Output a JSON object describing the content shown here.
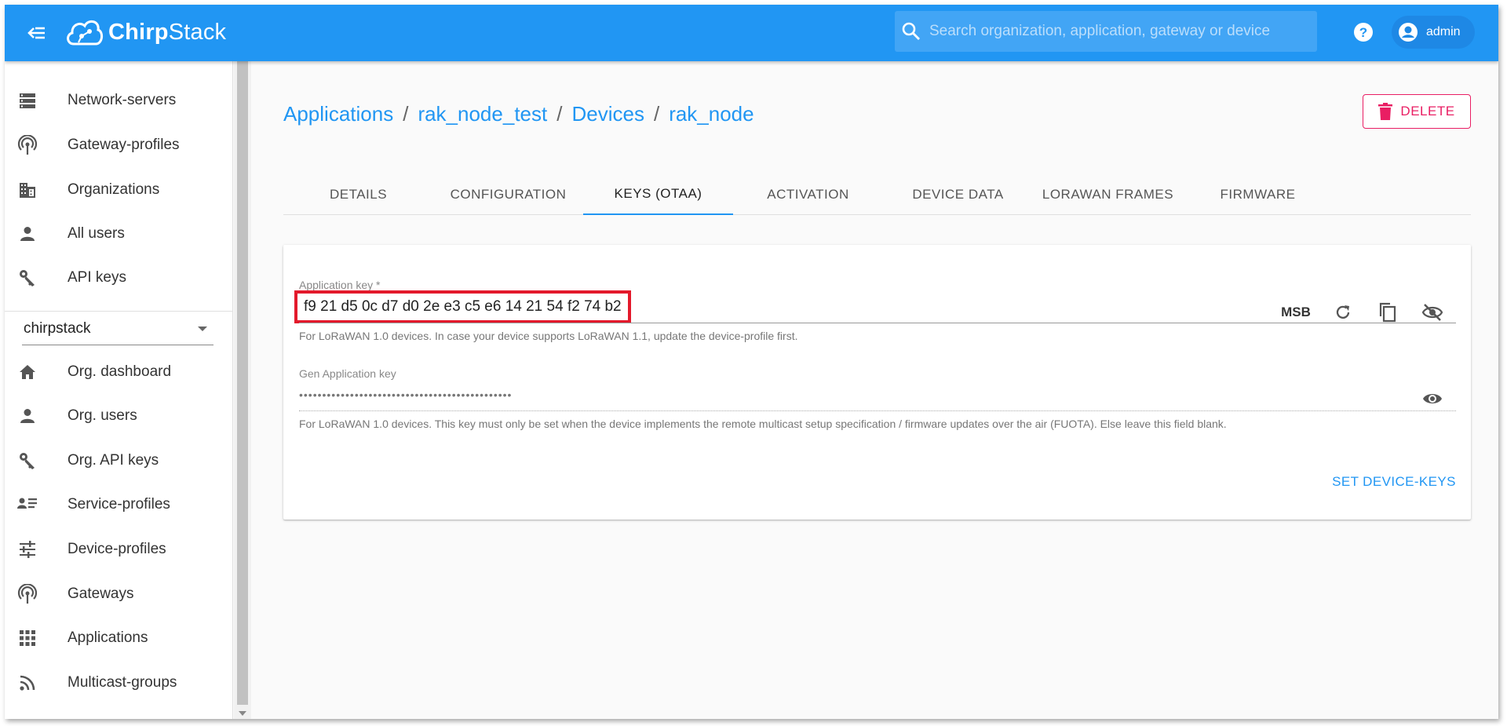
{
  "header": {
    "logo_text_bold": "Chirp",
    "logo_text_light": "Stack",
    "search_placeholder": "Search organization, application, gateway or device",
    "user_label": "admin"
  },
  "sidebar": {
    "global_items": [
      {
        "label": "Network-servers",
        "icon": "server-icon"
      },
      {
        "label": "Gateway-profiles",
        "icon": "gateway-icon"
      },
      {
        "label": "Organizations",
        "icon": "building-icon"
      },
      {
        "label": "All users",
        "icon": "person-icon"
      },
      {
        "label": "API keys",
        "icon": "key-icon"
      }
    ],
    "org_selected": "chirpstack",
    "org_items": [
      {
        "label": "Org. dashboard",
        "icon": "home-icon"
      },
      {
        "label": "Org. users",
        "icon": "person-icon"
      },
      {
        "label": "Org. API keys",
        "icon": "key-icon"
      },
      {
        "label": "Service-profiles",
        "icon": "profile-list-icon"
      },
      {
        "label": "Device-profiles",
        "icon": "sliders-icon"
      },
      {
        "label": "Gateways",
        "icon": "gateway-icon"
      },
      {
        "label": "Applications",
        "icon": "apps-grid-icon"
      },
      {
        "label": "Multicast-groups",
        "icon": "rss-icon"
      }
    ]
  },
  "breadcrumb": [
    "Applications",
    "rak_node_test",
    "Devices",
    "rak_node"
  ],
  "delete_label": "DELETE",
  "tabs": [
    {
      "label": "DETAILS",
      "active": false
    },
    {
      "label": "CONFIGURATION",
      "active": false
    },
    {
      "label": "KEYS (OTAA)",
      "active": true
    },
    {
      "label": "ACTIVATION",
      "active": false
    },
    {
      "label": "DEVICE DATA",
      "active": false
    },
    {
      "label": "LORAWAN FRAMES",
      "active": false
    },
    {
      "label": "FIRMWARE",
      "active": false
    }
  ],
  "form": {
    "app_key_label": "Application key *",
    "app_key_value": "f9 21 d5 0c d7 d0 2e e3 c5 e6 14 21 54 f2 74 b2",
    "byte_order": "MSB",
    "app_key_helper": "For LoRaWAN 1.0 devices. In case your device supports LoRaWAN 1.1, update the device-profile first.",
    "gen_key_label": "Gen Application key",
    "gen_key_masked": "••••••••••••••••••••••••••••••••••••••••••••••",
    "gen_key_helper": "For LoRaWAN 1.0 devices. This key must only be set when the device implements the remote multicast setup specification / firmware updates over the air (FUOTA). Else leave this field blank.",
    "submit_label": "SET DEVICE-KEYS"
  },
  "colors": {
    "primary": "#2196f3",
    "danger": "#e91e63",
    "highlight": "#e3192b"
  }
}
